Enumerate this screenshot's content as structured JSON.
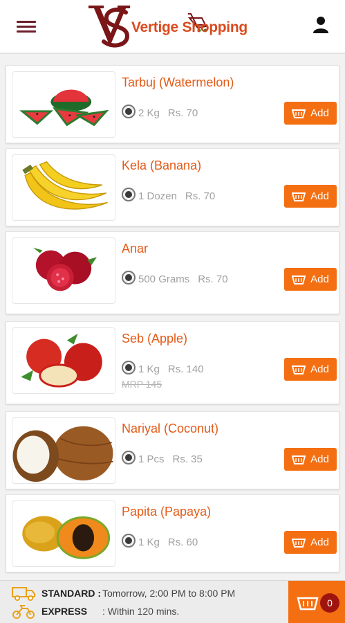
{
  "header": {
    "logo_text": "Vertige Shopping",
    "menu_icon": "hamburger-menu-icon",
    "user_icon": "user-icon",
    "brand_color": "#d94a1e"
  },
  "products": [
    {
      "name": "Tarbuj (Watermelon)",
      "quantity": "2 Kg",
      "price": "Rs. 70",
      "mrp": "",
      "add_label": "Add",
      "image": "watermelon-image"
    },
    {
      "name": "Kela (Banana)",
      "quantity": "1 Dozen",
      "price": "Rs. 70",
      "mrp": "",
      "add_label": "Add",
      "image": "banana-image"
    },
    {
      "name": "Anar",
      "quantity": "500 Grams",
      "price": "Rs. 70",
      "mrp": "",
      "add_label": "Add",
      "image": "pomegranate-image"
    },
    {
      "name": "Seb (Apple)",
      "quantity": "1 Kg",
      "price": "Rs. 140",
      "mrp": "MRP 145",
      "add_label": "Add",
      "image": "apple-image"
    },
    {
      "name": "Nariyal (Coconut)",
      "quantity": "1 Pcs",
      "price": "Rs. 35",
      "mrp": "",
      "add_label": "Add",
      "image": "coconut-image"
    },
    {
      "name": "Papita (Papaya)",
      "quantity": "1 Kg",
      "price": "Rs. 60",
      "mrp": "",
      "add_label": "Add",
      "image": "papaya-image"
    }
  ],
  "footer": {
    "standard_label": "STANDARD :",
    "standard_value": "Tomorrow, 2:00 PM to 8:00 PM",
    "express_label": "EXPRESS",
    "express_value": ": Within 120 mins.",
    "cart_count": "0",
    "accent_color": "#f46f12"
  }
}
